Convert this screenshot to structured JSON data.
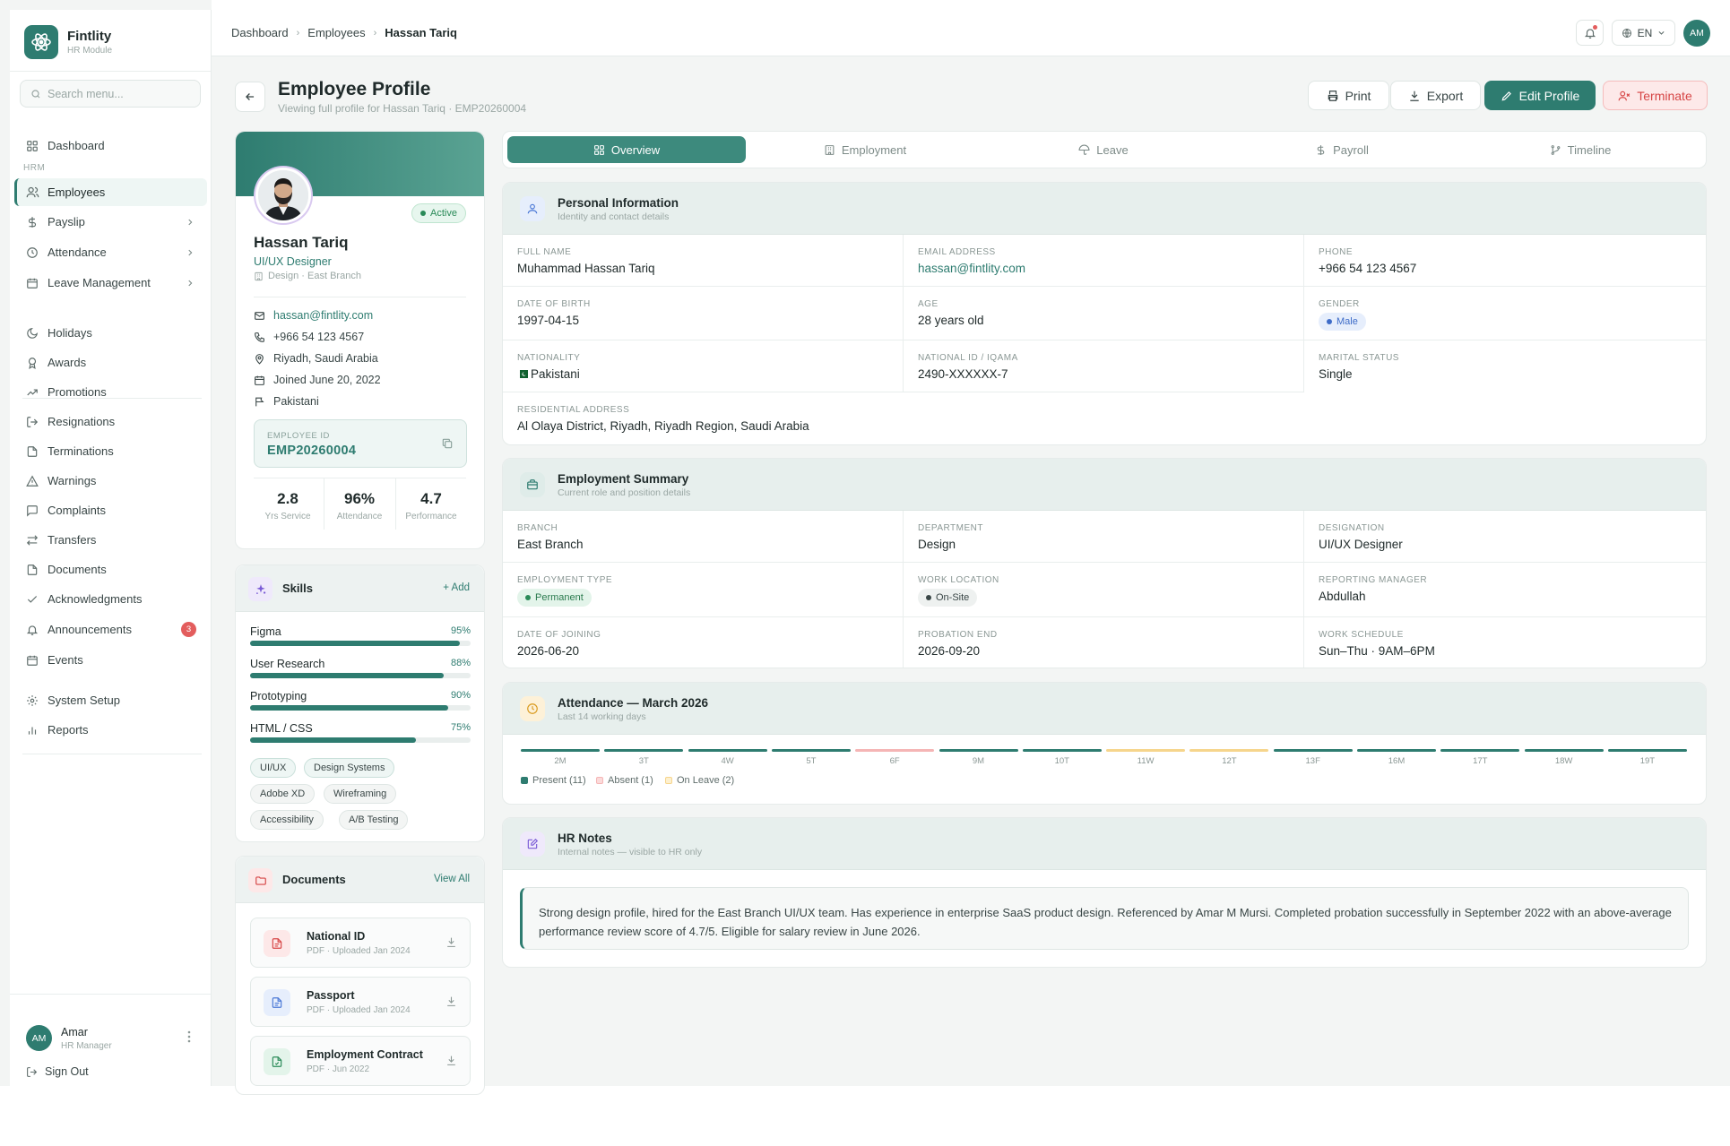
{
  "brand": {
    "name": "Fintlity",
    "sub": "HR Module",
    "logo_icon": "atom-icon"
  },
  "sidebar": {
    "search_placeholder": "Search menu...",
    "dashboard": "Dashboard",
    "section_label": "HRM",
    "items": [
      {
        "label": "Employees",
        "icon": "users-icon"
      },
      {
        "label": "Payslip",
        "icon": "dollar-icon"
      },
      {
        "label": "Attendance",
        "icon": "clock-icon"
      },
      {
        "label": "Leave Management",
        "icon": "calendar-icon"
      },
      {
        "label": "Holidays",
        "icon": "moon-icon"
      },
      {
        "label": "Awards",
        "icon": "award-icon"
      },
      {
        "label": "Promotions",
        "icon": "trending-up-icon"
      },
      {
        "label": "Resignations",
        "icon": "log-out-icon"
      },
      {
        "label": "Terminations",
        "icon": "file-icon"
      },
      {
        "label": "Warnings",
        "icon": "alert-triangle-icon"
      },
      {
        "label": "Complaints",
        "icon": "message-icon"
      },
      {
        "label": "Transfers",
        "icon": "transfer-icon"
      },
      {
        "label": "Documents",
        "icon": "file-icon"
      },
      {
        "label": "Acknowledgments",
        "icon": "check-icon"
      },
      {
        "label": "Announcements",
        "icon": "bell-icon",
        "badge": "3"
      },
      {
        "label": "Events",
        "icon": "calendar-icon"
      },
      {
        "label": "System Setup",
        "icon": "gear-icon"
      },
      {
        "label": "Reports",
        "icon": "bar-chart-icon"
      }
    ],
    "user": {
      "initials": "AM",
      "name": "Amar",
      "role": "HR Manager"
    },
    "sign_out": "Sign Out"
  },
  "topbar": {
    "crumbs": [
      "Dashboard",
      "Employees",
      "Hassan Tariq"
    ],
    "lang": "EN",
    "initials": "AM"
  },
  "header": {
    "title": "Employee Profile",
    "subtitle": "Viewing full profile for Hassan Tariq · EMP20260004",
    "print": "Print",
    "export": "Export",
    "edit": "Edit Profile",
    "terminate": "Terminate"
  },
  "profile": {
    "status": "Active",
    "name": "Hassan Tariq",
    "role": "UI/UX Designer",
    "dept": "Design · East Branch",
    "email": "hassan@fintlity.com",
    "phone": "+966 54 123 4567",
    "location": "Riyadh, Saudi Arabia",
    "joined": "Joined June 20, 2022",
    "nationality": "Pakistani",
    "emp_id_label": "EMPLOYEE ID",
    "emp_id": "EMP20260004",
    "stats": [
      {
        "value": "2.8",
        "label": "Yrs Service"
      },
      {
        "value": "96%",
        "label": "Attendance"
      },
      {
        "value": "4.7",
        "label": "Performance"
      }
    ]
  },
  "skills": {
    "title": "Skills",
    "add": "+ Add",
    "items": [
      {
        "name": "Figma",
        "pct": 95,
        "label": "95%"
      },
      {
        "name": "User Research",
        "pct": 88,
        "label": "88%"
      },
      {
        "name": "Prototyping",
        "pct": 90,
        "label": "90%"
      },
      {
        "name": "HTML / CSS",
        "pct": 75,
        "label": "75%"
      }
    ],
    "tags": [
      "UI/UX",
      "Design Systems",
      "Adobe XD",
      "Wireframing",
      "Accessibility",
      "A/B Testing"
    ]
  },
  "documents": {
    "title": "Documents",
    "view_all": "View All",
    "items": [
      {
        "name": "National ID",
        "meta": "PDF · Uploaded Jan 2024"
      },
      {
        "name": "Passport",
        "meta": "PDF · Uploaded Jan 2024"
      },
      {
        "name": "Employment Contract",
        "meta": "PDF · Jun 2022"
      }
    ]
  },
  "tabs": [
    "Overview",
    "Employment",
    "Leave",
    "Payroll",
    "Timeline"
  ],
  "personal": {
    "title": "Personal Information",
    "sub": "Identity and contact details",
    "full_name_l": "FULL NAME",
    "full_name": "Muhammad Hassan Tariq",
    "email_l": "EMAIL ADDRESS",
    "email": "hassan@fintlity.com",
    "phone_l": "PHONE",
    "phone": "+966 54 123 4567",
    "dob_l": "DATE OF BIRTH",
    "dob": "1997-04-15",
    "age_l": "AGE",
    "age": "28 years old",
    "gender_l": "GENDER",
    "gender": "Male",
    "nat_l": "NATIONALITY",
    "nat": "Pakistani",
    "natid_l": "NATIONAL ID / IQAMA",
    "natid": "2490-XXXXXX-7",
    "marital_l": "MARITAL STATUS",
    "marital": "Single",
    "addr_l": "RESIDENTIAL ADDRESS",
    "addr": "Al Olaya District, Riyadh, Riyadh Region, Saudi Arabia"
  },
  "employment": {
    "title": "Employment Summary",
    "sub": "Current role and position details",
    "branch_l": "BRANCH",
    "branch": "East Branch",
    "dept_l": "DEPARTMENT",
    "dept": "Design",
    "desig_l": "DESIGNATION",
    "desig": "UI/UX Designer",
    "type_l": "EMPLOYMENT TYPE",
    "type": "Permanent",
    "loc_l": "WORK LOCATION",
    "loc": "On-Site",
    "mgr_l": "REPORTING MANAGER",
    "mgr": "Abdullah",
    "doj_l": "DATE OF JOINING",
    "doj": "2026-06-20",
    "prob_l": "PROBATION END",
    "prob": "2026-09-20",
    "sched_l": "WORK SCHEDULE",
    "sched": "Sun–Thu · 9AM–6PM"
  },
  "attendance": {
    "title": "Attendance — March 2026",
    "sub": "Last 14 working days",
    "days": [
      {
        "label": "2M",
        "status": "present"
      },
      {
        "label": "3T",
        "status": "present"
      },
      {
        "label": "4W",
        "status": "present"
      },
      {
        "label": "5T",
        "status": "present"
      },
      {
        "label": "6F",
        "status": "absent"
      },
      {
        "label": "9M",
        "status": "present"
      },
      {
        "label": "10T",
        "status": "present"
      },
      {
        "label": "11W",
        "status": "leave"
      },
      {
        "label": "12T",
        "status": "leave"
      },
      {
        "label": "13F",
        "status": "present"
      },
      {
        "label": "16M",
        "status": "present"
      },
      {
        "label": "17T",
        "status": "present"
      },
      {
        "label": "18W",
        "status": "present"
      },
      {
        "label": "19T",
        "status": "present"
      }
    ],
    "legend": {
      "present": "Present (11)",
      "absent": "Absent (1)",
      "leave": "On Leave (2)"
    },
    "colors": {
      "present": "#2e7c70",
      "absent": "#f5b5b5",
      "leave": "#f6d58c"
    }
  },
  "notes": {
    "title": "HR Notes",
    "sub": "Internal notes — visible to HR only",
    "text": "Strong design profile, hired for the East Branch UI/UX team. Has experience in enterprise SaaS product design. Referenced by Amar M Mursi. Completed probation successfully in September 2022 with an above-average performance review score of 4.7/5. Eligible for salary review in June 2026."
  }
}
